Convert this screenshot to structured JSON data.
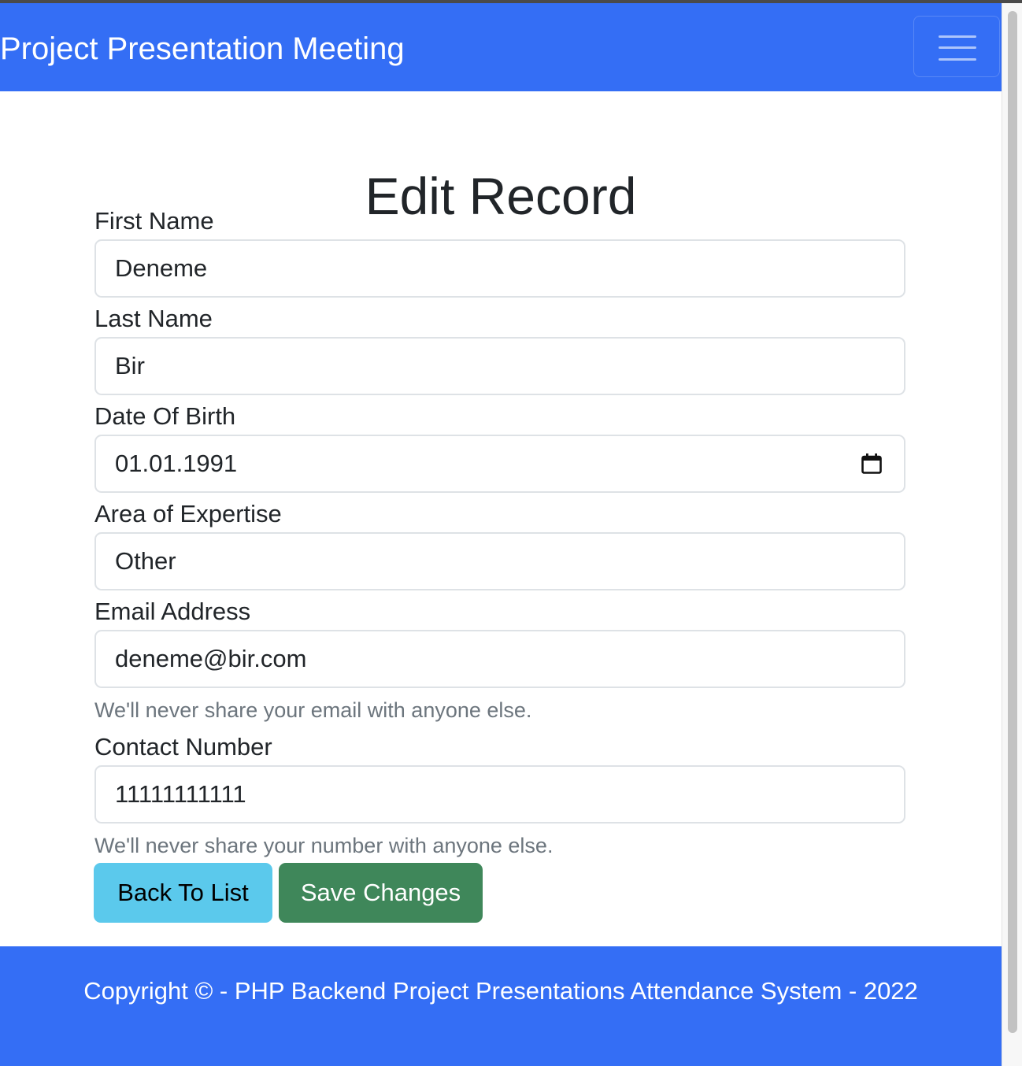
{
  "navbar": {
    "brand": "Project Presentation Meeting",
    "toggler_icon": "hamburger-menu-icon"
  },
  "page": {
    "title": "Edit Record"
  },
  "form": {
    "first_name": {
      "label": "First Name",
      "value": "Deneme"
    },
    "last_name": {
      "label": "Last Name",
      "value": "Bir"
    },
    "date_of_birth": {
      "label": "Date Of Birth",
      "value": "01.01.1991",
      "icon": "calendar-icon"
    },
    "expertise": {
      "label": "Area of Expertise",
      "value": "Other"
    },
    "email": {
      "label": "Email Address",
      "value": "deneme@bir.com",
      "help": "We'll never share your email with anyone else."
    },
    "contact": {
      "label": "Contact Number",
      "value": "11111111111",
      "help": "We'll never share your number with anyone else."
    }
  },
  "buttons": {
    "back": "Back To List",
    "save": "Save Changes"
  },
  "footer": {
    "text": "Copyright © - PHP Backend Project Presentations Attendance System - 2022"
  },
  "colors": {
    "primary": "#346ef5",
    "info": "#5bc9ec",
    "success": "#3f875a"
  }
}
